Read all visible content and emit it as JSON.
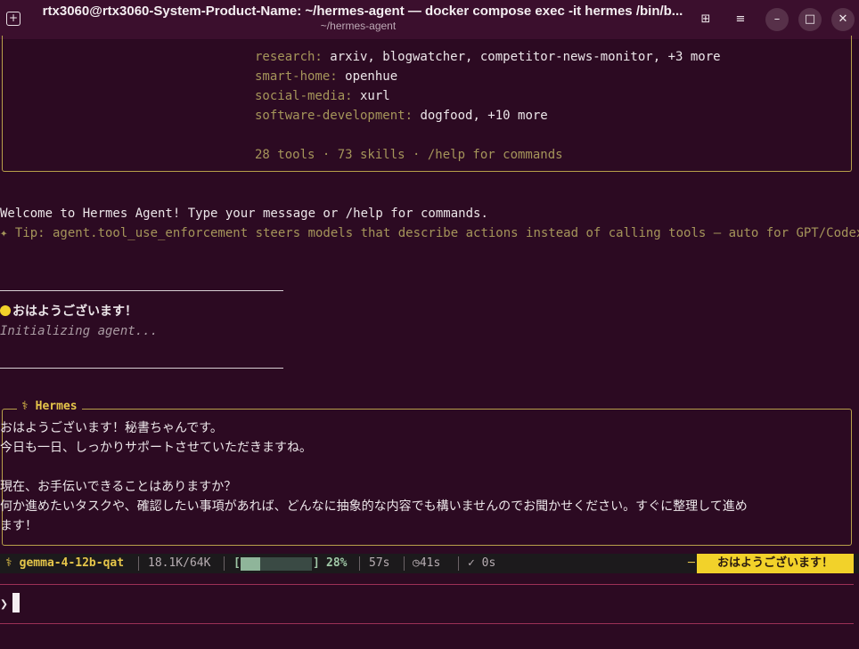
{
  "window": {
    "title": "rtx3060@rtx3060-System-Product-Name: ~/hermes-agent — docker compose exec -it hermes /bin/b...",
    "subtitle": "~/hermes-agent",
    "buttons": {
      "grid": "⊞",
      "menu": "≡",
      "minimize": "–",
      "maximize": "□",
      "close": "✕"
    }
  },
  "skills": [
    {
      "key": "research:",
      "value": " arxiv, blogwatcher, competitor-news-monitor, +3 more"
    },
    {
      "key": "smart-home:",
      "value": " openhue"
    },
    {
      "key": "social-media:",
      "value": " xurl"
    },
    {
      "key": "software-development:",
      "value": " dogfood, +10 more"
    }
  ],
  "summary": "28 tools · 73 skills · /help for commands",
  "welcome": "Welcome to Hermes Agent! Type your message or /help for commands.",
  "tip": "✦ Tip: agent.tool_use_enforcement steers models that describe actions instead of calling tools — auto for GPT/Codex.",
  "user_message": "おはようございます！",
  "initializing": "Initializing agent...",
  "response": {
    "label": "⚕ Hermes",
    "lines": [
      "おはようございます！秘書ちゃんです。",
      "今日も一日、しっかりサポートさせていただきますね。",
      "",
      "現在、お手伝いできることはありますか？",
      "何か進めたいタスクや、確認したい事項があれば、どんなに抽象的な内容でも構いませんのでお聞かせください。すぐに整理して進め",
      "ます！"
    ]
  },
  "status": {
    "model": "⚕ gemma-4-12b-qat",
    "tokens": "18.1K/64K",
    "bar_open": "[",
    "bar_close": "]",
    "progress_percent": 28,
    "percent": "28%",
    "elapsed": "57s",
    "timer": "41s",
    "check": "✓ 0s",
    "badge": "おはようございます！"
  },
  "prompt": {
    "symbol": "❯",
    "value": ""
  },
  "colors": {
    "background": "#2c0a22",
    "accent": "#e6c64a",
    "badge": "#f2d22a"
  }
}
